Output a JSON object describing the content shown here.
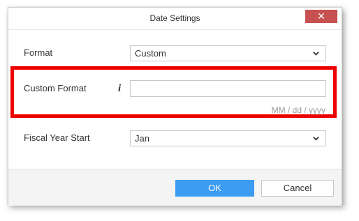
{
  "dialog": {
    "title": "Date Settings",
    "close_icon": "close-icon"
  },
  "format": {
    "label": "Format",
    "value": "Custom"
  },
  "custom_format": {
    "label": "Custom Format",
    "info_icon": "info-icon",
    "value": "",
    "hint": "MM / dd / yyyy"
  },
  "fiscal_year_start": {
    "label": "Fiscal Year Start",
    "value": "Jan"
  },
  "footer": {
    "ok_label": "OK",
    "cancel_label": "Cancel"
  },
  "colors": {
    "close_button": "#c75050",
    "highlight_border": "#ee0000",
    "primary_button": "#3b9cf2"
  }
}
